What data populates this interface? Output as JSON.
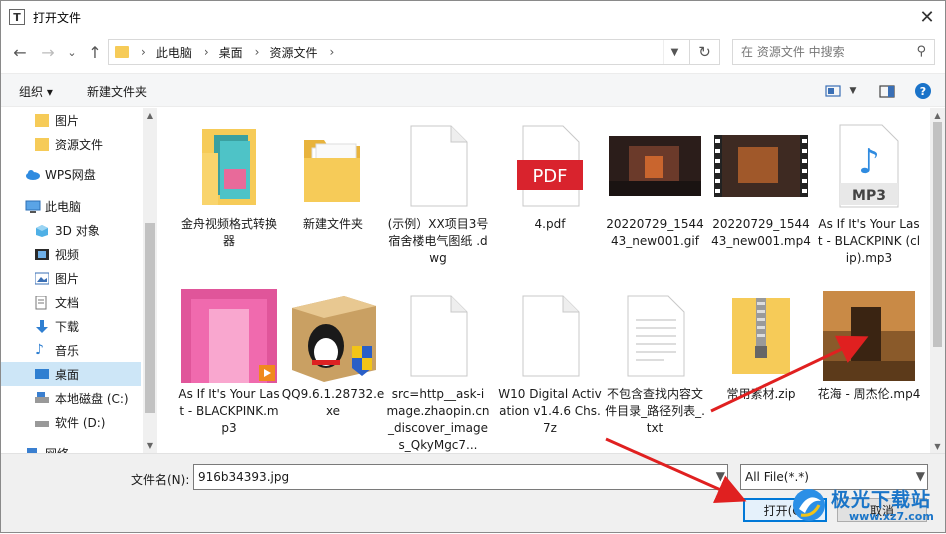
{
  "window": {
    "title": "打开文件",
    "app_icon_letter": "T",
    "close_glyph": "✕"
  },
  "nav": {
    "back": "←",
    "forward": "→",
    "dropdown": "⌄",
    "up": "↑",
    "breadcrumb": [
      "此电脑",
      "桌面",
      "资源文件"
    ],
    "separator": "›",
    "refresh": "↻",
    "search_placeholder": "在 资源文件 中搜索"
  },
  "toolbar": {
    "organize": "组织 ▾",
    "new_folder": "新建文件夹",
    "help": "?"
  },
  "sidebar": {
    "items": [
      {
        "label": "图片",
        "icon": "folder-icon"
      },
      {
        "label": "资源文件",
        "icon": "folder-icon"
      },
      {
        "label": "WPS网盘",
        "icon": "cloud-icon"
      },
      {
        "label": "此电脑",
        "icon": "computer-icon"
      },
      {
        "label": "3D 对象",
        "icon": "cube-icon"
      },
      {
        "label": "视频",
        "icon": "video-icon"
      },
      {
        "label": "图片",
        "icon": "picture-icon"
      },
      {
        "label": "文档",
        "icon": "document-icon"
      },
      {
        "label": "下载",
        "icon": "download-icon"
      },
      {
        "label": "音乐",
        "icon": "music-icon"
      },
      {
        "label": "桌面",
        "icon": "desktop-icon"
      },
      {
        "label": "本地磁盘 (C:)",
        "icon": "drive-icon"
      },
      {
        "label": "软件 (D:)",
        "icon": "drive-icon"
      },
      {
        "label": "网络",
        "icon": "network-icon"
      }
    ]
  },
  "files": [
    {
      "name": "金舟视频格式转换器",
      "kind": "shortcut-folder"
    },
    {
      "name": "新建文件夹",
      "kind": "folder"
    },
    {
      "name": "(示例）XX项目3号宿舍楼电气图纸 .dwg",
      "kind": "blank"
    },
    {
      "name": "4.pdf",
      "kind": "pdf",
      "badge": "PDF"
    },
    {
      "name": "20220729_154443_new001.gif",
      "kind": "image-dark"
    },
    {
      "name": "20220729_154443_new001.mp4",
      "kind": "video-dark"
    },
    {
      "name": "As If It's Your Last - BLACKPINK (clip).mp3",
      "kind": "mp3",
      "badge": "MP3"
    },
    {
      "name": "As If It's Your Last - BLACKPINK.mp3",
      "kind": "image-pink"
    },
    {
      "name": "QQ9.6.1.28732.exe",
      "kind": "qq"
    },
    {
      "name": "src=http__ask-image.zhaopin.cn_discover_images_QkyMgc7...",
      "kind": "blank"
    },
    {
      "name": "W10 Digital Activation v1.4.6 Chs.7z",
      "kind": "blank"
    },
    {
      "name": "不包含查找内容文件目录_路径列表_.txt",
      "kind": "text"
    },
    {
      "name": "常用素材.zip",
      "kind": "zip"
    },
    {
      "name": "花海 - 周杰伦.mp4",
      "kind": "image-warm"
    }
  ],
  "bottom": {
    "filename_label": "文件名(N):",
    "filename_value": "916b34393.jpg",
    "filter_value": "All File(*.*)",
    "open_button": "打开(O)",
    "cancel_button": "取消"
  },
  "watermark": {
    "title": "极光下载站",
    "url": "www.xz7.com"
  },
  "colors": {
    "accent": "#0078d7",
    "folder": "#f6cb58",
    "selection": "#cde6f7",
    "arrow": "#e02020",
    "pdf": "#d9232d"
  }
}
